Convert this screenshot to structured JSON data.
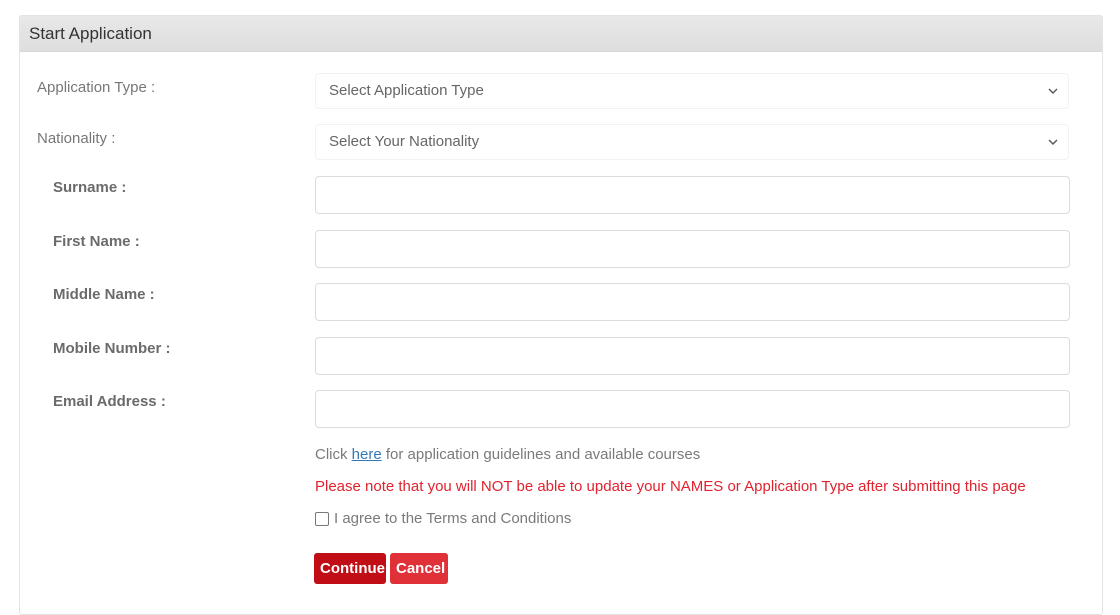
{
  "panel": {
    "title": "Start Application"
  },
  "form": {
    "application_type": {
      "label": "Application Type :",
      "selected": "Select Application Type"
    },
    "nationality": {
      "label": "Nationality :",
      "selected": "Select Your Nationality"
    },
    "surname": {
      "label": "Surname :",
      "value": "",
      "placeholder": ""
    },
    "first_name": {
      "label": "First Name :",
      "value": "",
      "placeholder": ""
    },
    "middle_name": {
      "label": "Middle Name :",
      "value": "",
      "placeholder": ""
    },
    "mobile_number": {
      "label": "Mobile Number :",
      "value": "",
      "placeholder": ""
    },
    "email_address": {
      "label": "Email Address :",
      "value": "",
      "placeholder": ""
    }
  },
  "guidelines": {
    "prefix": "Click ",
    "link_text": "here",
    "suffix": " for application guidelines and available courses"
  },
  "warning": "Please note that you will NOT be able to update your NAMES or Application Type after submitting this page",
  "terms": {
    "label": "I agree to the Terms and Conditions",
    "checked": false
  },
  "buttons": {
    "continue": "Continue",
    "cancel": "Cancel"
  },
  "colors": {
    "continue_bg": "#c10e16",
    "cancel_bg": "#e03038",
    "warning": "#e0232f",
    "link": "#337ab7"
  },
  "icons": {
    "select_chevron": "chevron-down-icon"
  }
}
